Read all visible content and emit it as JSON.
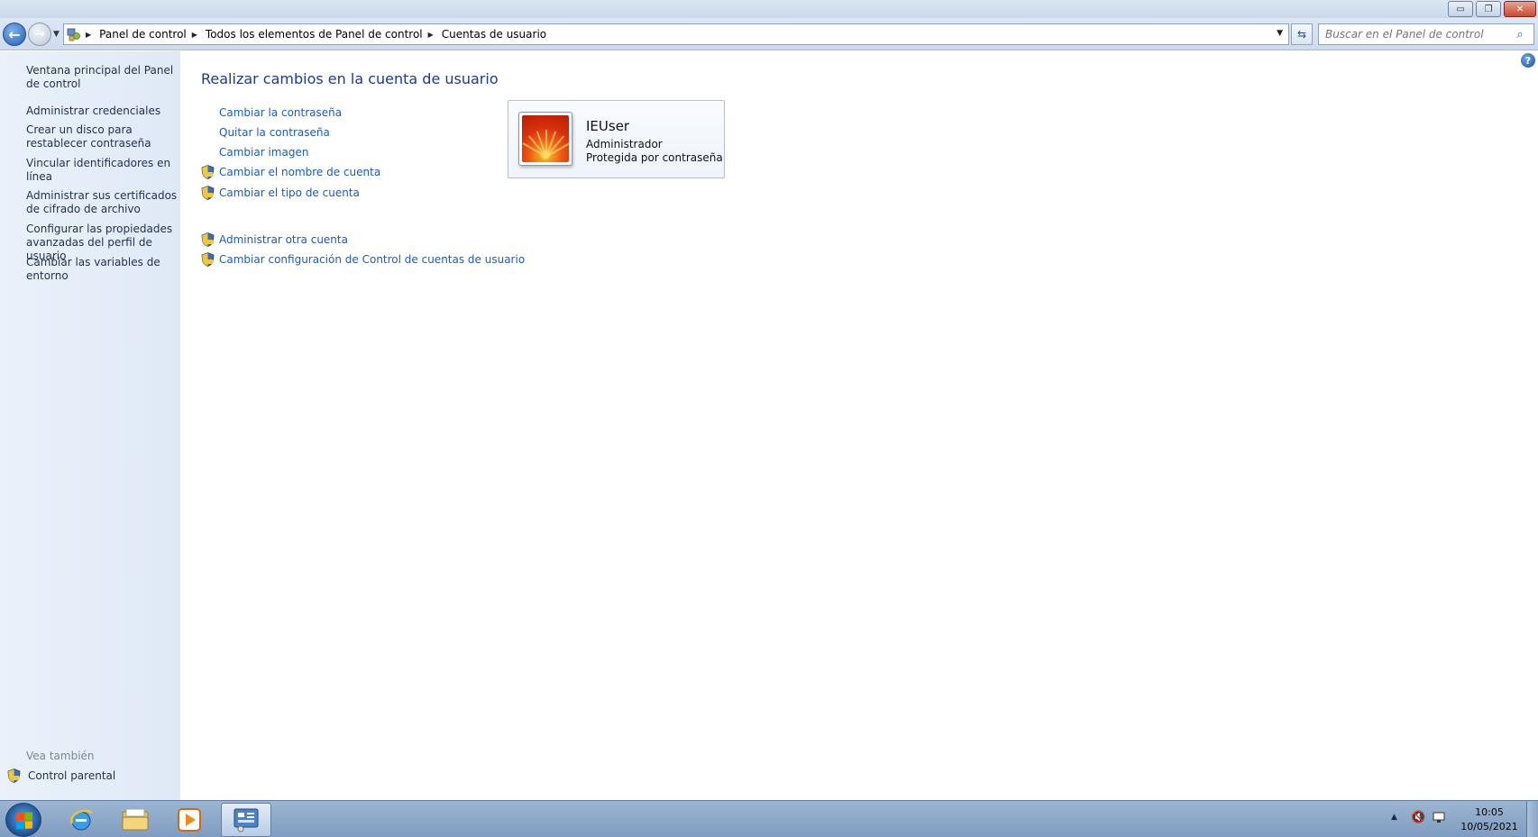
{
  "window": {
    "minimize_label": "▭",
    "restore_label": "❐",
    "close_label": "✕"
  },
  "address": {
    "crumbs": [
      "Panel de control",
      "Todos los elementos de Panel de control",
      "Cuentas de usuario"
    ]
  },
  "search": {
    "placeholder": "Buscar en el Panel de control"
  },
  "sidebar": {
    "items": [
      {
        "label": "Ventana principal del Panel de control"
      },
      {
        "label": "Administrar credenciales"
      },
      {
        "label": "Crear un disco para restablecer contraseña"
      },
      {
        "label": "Vincular identificadores en línea"
      },
      {
        "label": "Administrar sus certificados de cifrado de archivo"
      },
      {
        "label": "Configurar las propiedades avanzadas del perfil de usuario"
      },
      {
        "label": "Cambiar las variables de entorno"
      }
    ],
    "see_also_label": "Vea también",
    "parental_label": "Control parental"
  },
  "main": {
    "title": "Realizar cambios en la cuenta de usuario",
    "tasks": [
      {
        "label": "Cambiar la contraseña",
        "shield": false
      },
      {
        "label": "Quitar la contraseña",
        "shield": false
      },
      {
        "label": "Cambiar imagen",
        "shield": false
      },
      {
        "label": "Cambiar el nombre de cuenta",
        "shield": true
      },
      {
        "label": "Cambiar el tipo de cuenta",
        "shield": true
      },
      {
        "label": "Administrar otra cuenta",
        "shield": true
      },
      {
        "label": "Cambiar configuración de Control de cuentas de usuario",
        "shield": true
      }
    ],
    "user": {
      "name": "IEUser",
      "role": "Administrador",
      "status": "Protegida por contraseña"
    }
  },
  "taskbar": {
    "clock_time": "10:05",
    "clock_date": "10/05/2021"
  },
  "colors": {
    "link": "#1f5bb5",
    "title": "#1e3b8a",
    "sidebar_bg": "#e4edf8"
  }
}
